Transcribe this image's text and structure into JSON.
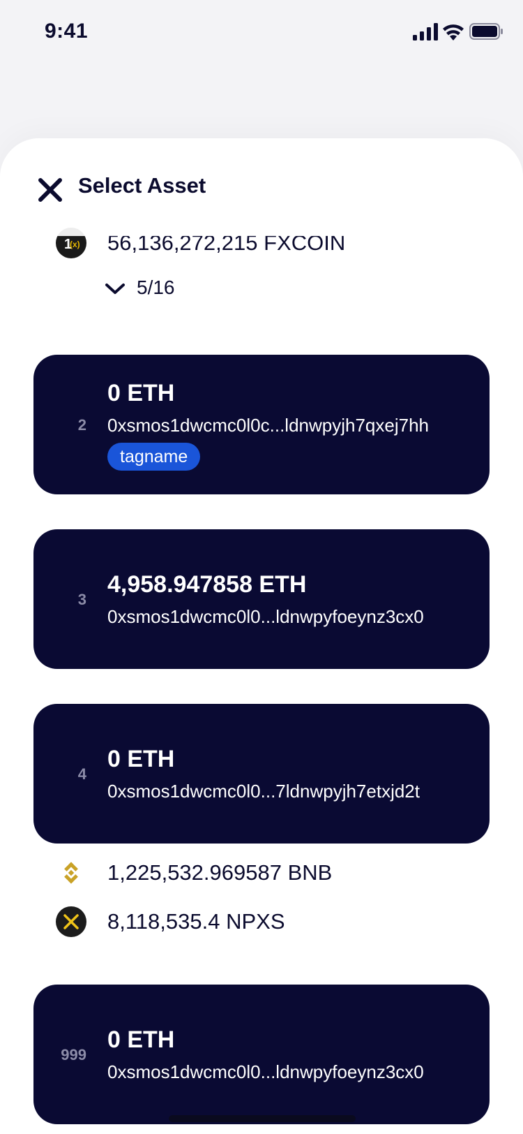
{
  "status_bar": {
    "time": "9:41",
    "icons": [
      "cellular-signal-icon",
      "wifi-icon",
      "battery-icon"
    ]
  },
  "sheet": {
    "title": "Select Asset",
    "close_icon": "close-icon"
  },
  "assets_top": {
    "fx": {
      "icon": "fxcoin-icon",
      "text": "56,136,272,215 FXCOIN"
    },
    "expand": {
      "icon": "chevron-down-icon",
      "count": "5/16"
    }
  },
  "cards": [
    {
      "index": "2",
      "amount": "0 ETH",
      "address": "0xsmos1dwcmc0l0c...ldnwpyjh7qxej7hh",
      "tag": "tagname"
    },
    {
      "index": "3",
      "amount": "4,958.947858 ETH",
      "address": "0xsmos1dwcmc0l0...ldnwpyfoeynz3cx0"
    },
    {
      "index": "4",
      "amount": "0 ETH",
      "address": "0xsmos1dwcmc0l0...7ldnwpyjh7etxjd2t"
    },
    {
      "index": "999",
      "amount": "0 ETH",
      "address": "0xsmos1dwcmc0l0...ldnwpyfoeynz3cx0"
    }
  ],
  "assets_mid": [
    {
      "icon": "bnb-icon",
      "text": "1,225,532.969587 BNB"
    },
    {
      "icon": "npxs-icon",
      "text": "8,118,535.4 NPXS"
    }
  ],
  "colors": {
    "card_bg": "#0a0a33",
    "tag_bg": "#1a55d9",
    "text_dark": "#0b0b2e",
    "gold": "#c9a227"
  }
}
